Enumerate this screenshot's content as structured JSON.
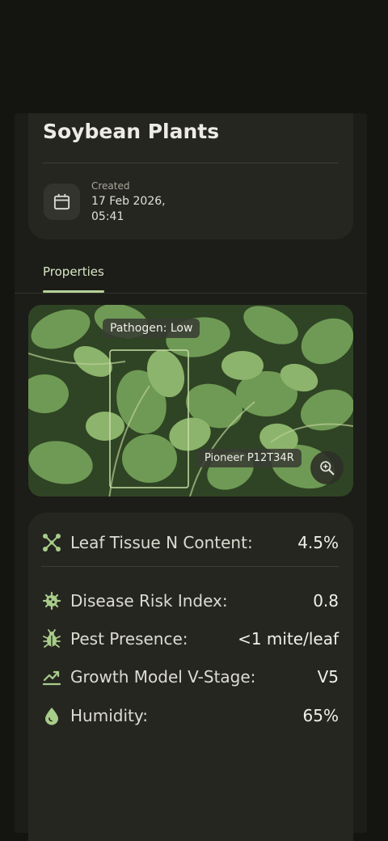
{
  "header": {
    "title": "Soybean Plants",
    "created_label": "Created",
    "created_value": "17 Feb 2026, 05:41"
  },
  "tabs": [
    {
      "label": "Properties",
      "selected": true
    }
  ],
  "photo": {
    "detection_label": "Pathogen: Low",
    "variety_label": "Pioneer P12T34R",
    "zoom_icon": "zoom-in-icon"
  },
  "properties": [
    {
      "icon": "nodes-icon",
      "label": "Leaf Tissue N Content:",
      "value": "4.5%"
    },
    {
      "icon": "virus-icon",
      "label": "Disease Risk Index:",
      "value": "0.8"
    },
    {
      "icon": "bug-icon",
      "label": "Pest Presence:",
      "value": "<1 mite/leaf"
    },
    {
      "icon": "trend-up-icon",
      "label": "Growth Model V-Stage:",
      "value": "V5"
    },
    {
      "icon": "water-drop-icon",
      "label": "Humidity:",
      "value": "65%"
    }
  ],
  "colors": {
    "accent": "#b4d296",
    "icon": "#a8cc8a",
    "background": "#141411",
    "card": "#262621"
  }
}
